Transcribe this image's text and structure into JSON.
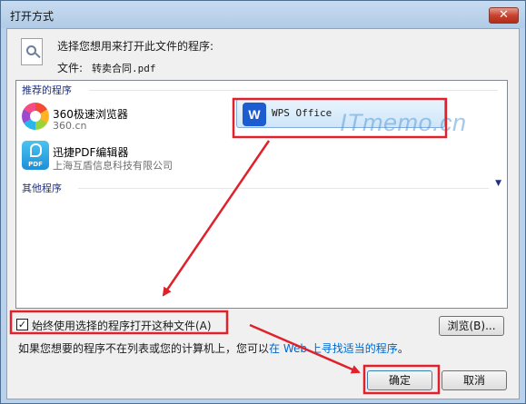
{
  "window": {
    "title": "打开方式",
    "close_glyph": "✕"
  },
  "prompt": {
    "text": "选择您想用来打开此文件的程序:",
    "file_label": "文件:",
    "file_name": "转卖合同.pdf"
  },
  "program_list": {
    "recommended_header": "推荐的程序",
    "other_header": "其他程序",
    "apps": [
      {
        "name": "360极速浏览器",
        "sub": "360.cn",
        "icon": "360-browser-icon"
      },
      {
        "name": "迅捷PDF编辑器",
        "sub": "上海互盾信息科技有限公司",
        "icon": "pdf-editor-icon"
      }
    ],
    "selected_app": {
      "name": "WPS Office",
      "icon": "wps-icon",
      "icon_letter": "W"
    },
    "pdf_icon_label": "PDF"
  },
  "watermark": "ITmemo.cn",
  "options": {
    "always_use_label": "始终使用选择的程序打开这种文件(A)",
    "always_use_checked": true,
    "check_glyph": "✓"
  },
  "buttons": {
    "browse": "浏览(B)...",
    "ok": "确定",
    "cancel": "取消"
  },
  "footer": {
    "text_before": "如果您想要的程序不在列表或您的计算机上，您可以",
    "link": "在 Web 上寻找适当的程序",
    "text_after": "。"
  },
  "annotations": {
    "color": "#e0202a"
  }
}
